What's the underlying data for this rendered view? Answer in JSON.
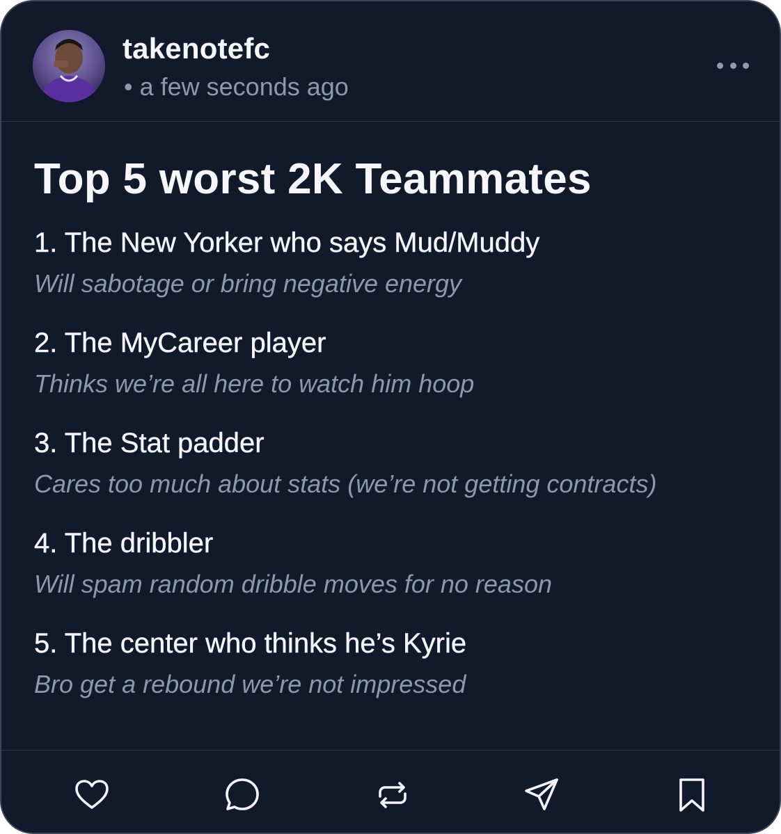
{
  "post": {
    "username": "takenotefc",
    "timestamp": "• a few seconds ago",
    "title": "Top 5 worst 2K Teammates",
    "items": [
      {
        "title": "1. The New Yorker who says Mud/Muddy",
        "description": "Will sabotage or bring negative energy"
      },
      {
        "title": "2. The MyCareer player",
        "description": "Thinks we’re all here to watch him hoop"
      },
      {
        "title": "3. The Stat padder",
        "description": "Cares too much about stats (we’re not getting contracts)"
      },
      {
        "title": "4. The dribbler",
        "description": "Will spam random dribble moves for no reason"
      },
      {
        "title": "5. The center who thinks he’s Kyrie",
        "description": "Bro get a rebound we’re not impressed"
      }
    ]
  },
  "icons": {
    "more": "more-dots-icon",
    "like": "heart-icon",
    "comment": "speech-bubble-icon",
    "repost": "repost-arrows-icon",
    "share": "send-plane-icon",
    "bookmark": "bookmark-icon"
  },
  "colors": {
    "background": "#111a2b",
    "text_primary": "#f3f5f8",
    "text_secondary": "#8d98ab",
    "divider": "#2e3849"
  }
}
